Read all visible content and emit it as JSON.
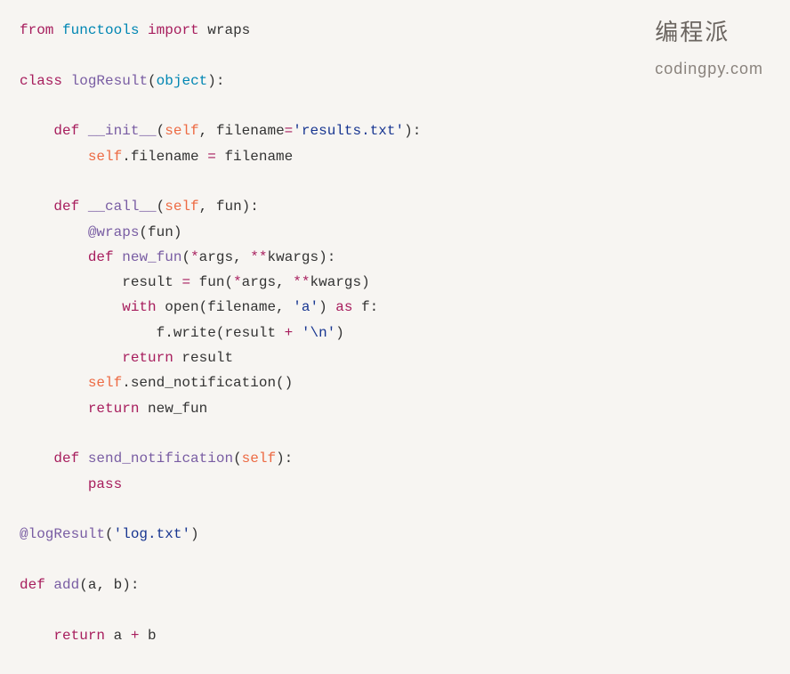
{
  "watermark": {
    "cn": "编程派",
    "en": "codingpy.com"
  },
  "code": {
    "l1": {
      "from": "from",
      "mod": "functools",
      "import": "import",
      "wraps": "wraps"
    },
    "l3": {
      "class": "class",
      "name": "logResult",
      "obj": "object"
    },
    "l5": {
      "def": "def",
      "fn": "__init__",
      "self": "self",
      "p": "filename",
      "eq": "=",
      "str": "'results.txt'"
    },
    "l6": {
      "self": "self",
      "attr": ".filename ",
      "eq": "=",
      "rhs": " filename"
    },
    "l8": {
      "def": "def",
      "fn": "__call__",
      "self": "self",
      "p": "fun"
    },
    "l9": {
      "at": "@wraps",
      "arg": "fun"
    },
    "l10": {
      "def": "def",
      "fn": "new_fun",
      "star": "*",
      "args": "args",
      "dstar": "**",
      "kwargs": "kwargs"
    },
    "l11": {
      "lhs": "result ",
      "eq": "=",
      "mid": " fun(",
      "star": "*",
      "args": "args",
      "c": ", ",
      "dstar": "**",
      "kwargs": "kwargs",
      "end": ")"
    },
    "l12": {
      "with": "with",
      "open": " open(filename, ",
      "str": "'a'",
      "as": "as",
      "f": " f:"
    },
    "l13": {
      "pre": "f.write(result ",
      "plus": "+",
      "str": " '\\n'",
      "end": ")"
    },
    "l14": {
      "ret": "return",
      "v": " result"
    },
    "l15": {
      "self": "self",
      "rest": ".send_notification()"
    },
    "l16": {
      "ret": "return",
      "v": " new_fun"
    },
    "l18": {
      "def": "def",
      "fn": "send_notification",
      "self": "self"
    },
    "l19": {
      "pass": "pass"
    },
    "l21": {
      "at": "@logResult",
      "str": "'log.txt'"
    },
    "l23": {
      "def": "def",
      "fn": "add",
      "p": "a, b"
    },
    "l25": {
      "ret": "return",
      "expr": " a ",
      "plus": "+",
      "rest": " b"
    }
  }
}
